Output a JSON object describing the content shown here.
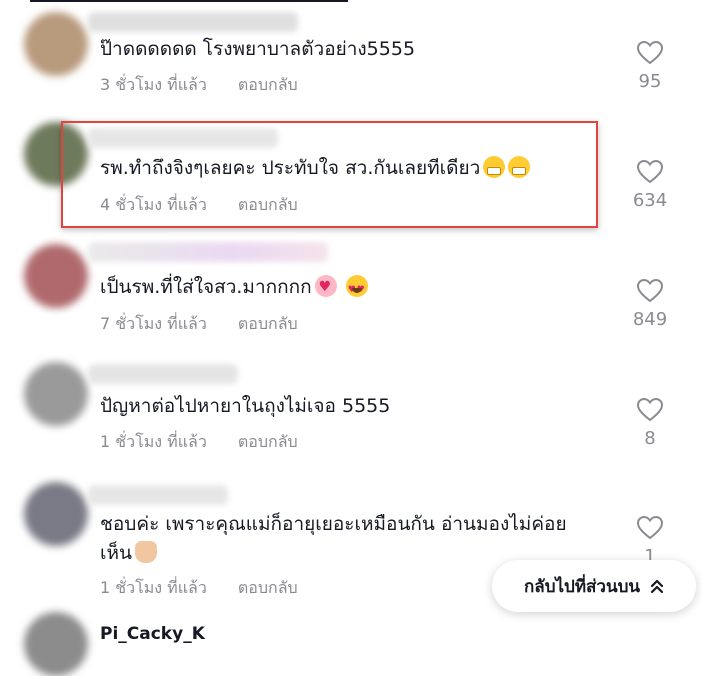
{
  "comments": [
    {
      "text": "ป๊าดดดดดด โรงพยาบาลตัวอย่าง5555",
      "time": "3 ชั่วโมง ที่แล้ว",
      "reply": "ตอบกลับ",
      "likes": "95"
    },
    {
      "text": "รพ.ทำถึงจิงๆเลยคะ ประทับใจ สว.กันเลยทีเดียว",
      "time": "4 ชั่วโมง ที่แล้ว",
      "reply": "ตอบกลับ",
      "likes": "634"
    },
    {
      "text": "เป็นรพ.ที่ใส่ใจสว.มากกกก",
      "time": "7 ชั่วโมง ที่แล้ว",
      "reply": "ตอบกลับ",
      "likes": "849"
    },
    {
      "text": "ปัญหาต่อไปหายาในถุงไม่เจอ 5555",
      "time": "1 ชั่วโมง ที่แล้ว",
      "reply": "ตอบกลับ",
      "likes": "8"
    },
    {
      "text": "ชอบค่ะ เพราะคุณแม่ก็อายุเยอะเหมือนกัน อ่านมองไม่ค่อยเห็น",
      "time": "1 ชั่วโมง ที่แล้ว",
      "reply": "ตอบกลับ",
      "likes": "1"
    }
  ],
  "back_to_top": {
    "label": "กลับไปที่ส่วนบน"
  },
  "next_comment_peek": "Pi_Cacky_K"
}
